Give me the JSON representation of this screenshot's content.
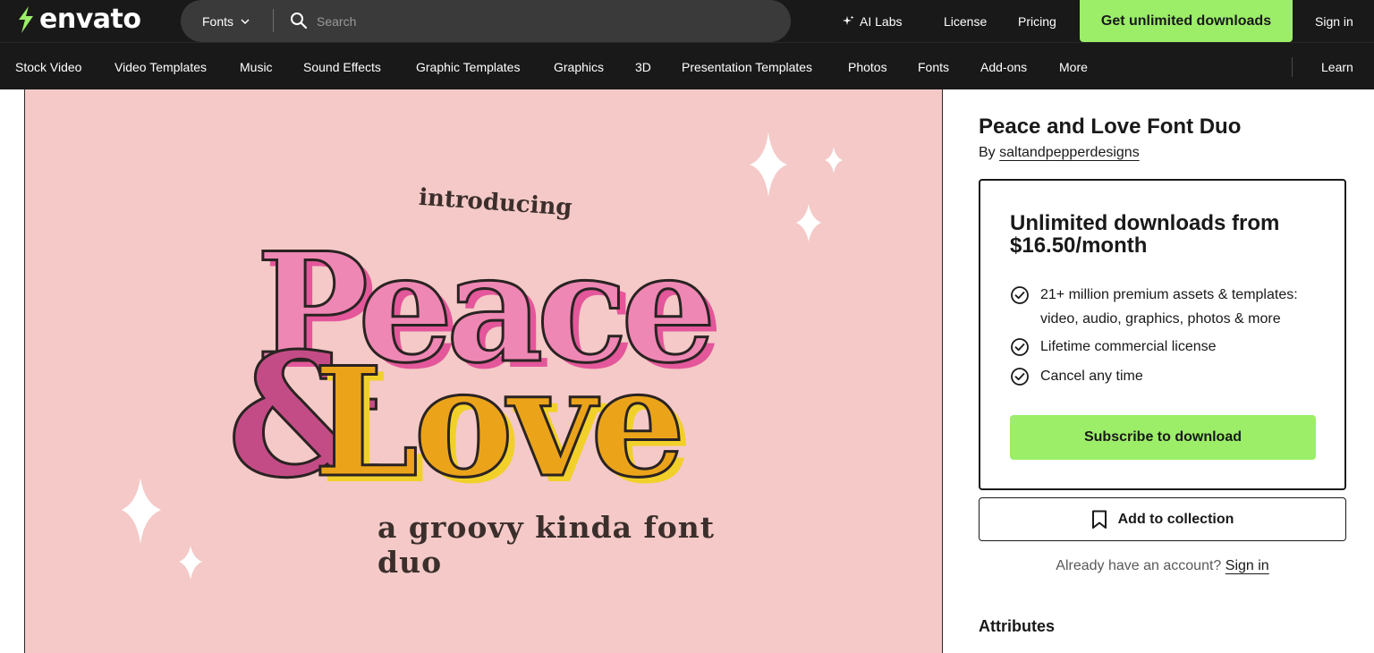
{
  "header": {
    "logo_text": "envato",
    "category_select": "Fonts",
    "search_placeholder": "Search",
    "ai_labs": "AI Labs",
    "license": "License",
    "pricing": "Pricing",
    "cta": "Get unlimited downloads",
    "sign_in": "Sign in"
  },
  "nav": {
    "items": [
      "Stock Video",
      "Video Templates",
      "Music",
      "Sound Effects",
      "Graphic Templates",
      "Graphics",
      "3D",
      "Presentation Templates",
      "Photos",
      "Fonts",
      "Add-ons",
      "More"
    ],
    "learn": "Learn"
  },
  "preview": {
    "intro": "introducing",
    "line1": "Peace",
    "amp": "&",
    "line2": "Love",
    "tagline": "a groovy kinda font duo"
  },
  "product": {
    "title": "Peace and Love Font Duo",
    "by_prefix": "By",
    "author": "saltandpepperdesigns"
  },
  "pricing_card": {
    "heading": "Unlimited downloads from $16.50/month",
    "features": [
      "21+ million premium assets & templates: video, audio, graphics, photos & more",
      "Lifetime commercial license",
      "Cancel any time"
    ],
    "subscribe": "Subscribe to download"
  },
  "collection_button": "Add to collection",
  "account": {
    "prompt": "Already have an account?",
    "sign_in": "Sign in"
  },
  "attributes_heading": "Attributes",
  "colors": {
    "header_bg": "#191919",
    "accent_green": "#9cee69",
    "preview_bg": "#f4c9c7",
    "peace_pink": "#ef87b4",
    "love_orange": "#eba41a",
    "amp_magenta": "#c44c86"
  },
  "icons": [
    "envato-leaf-icon",
    "chevron-down-icon",
    "search-icon",
    "sparkle-icon",
    "check-circle-icon",
    "bookmark-icon"
  ]
}
